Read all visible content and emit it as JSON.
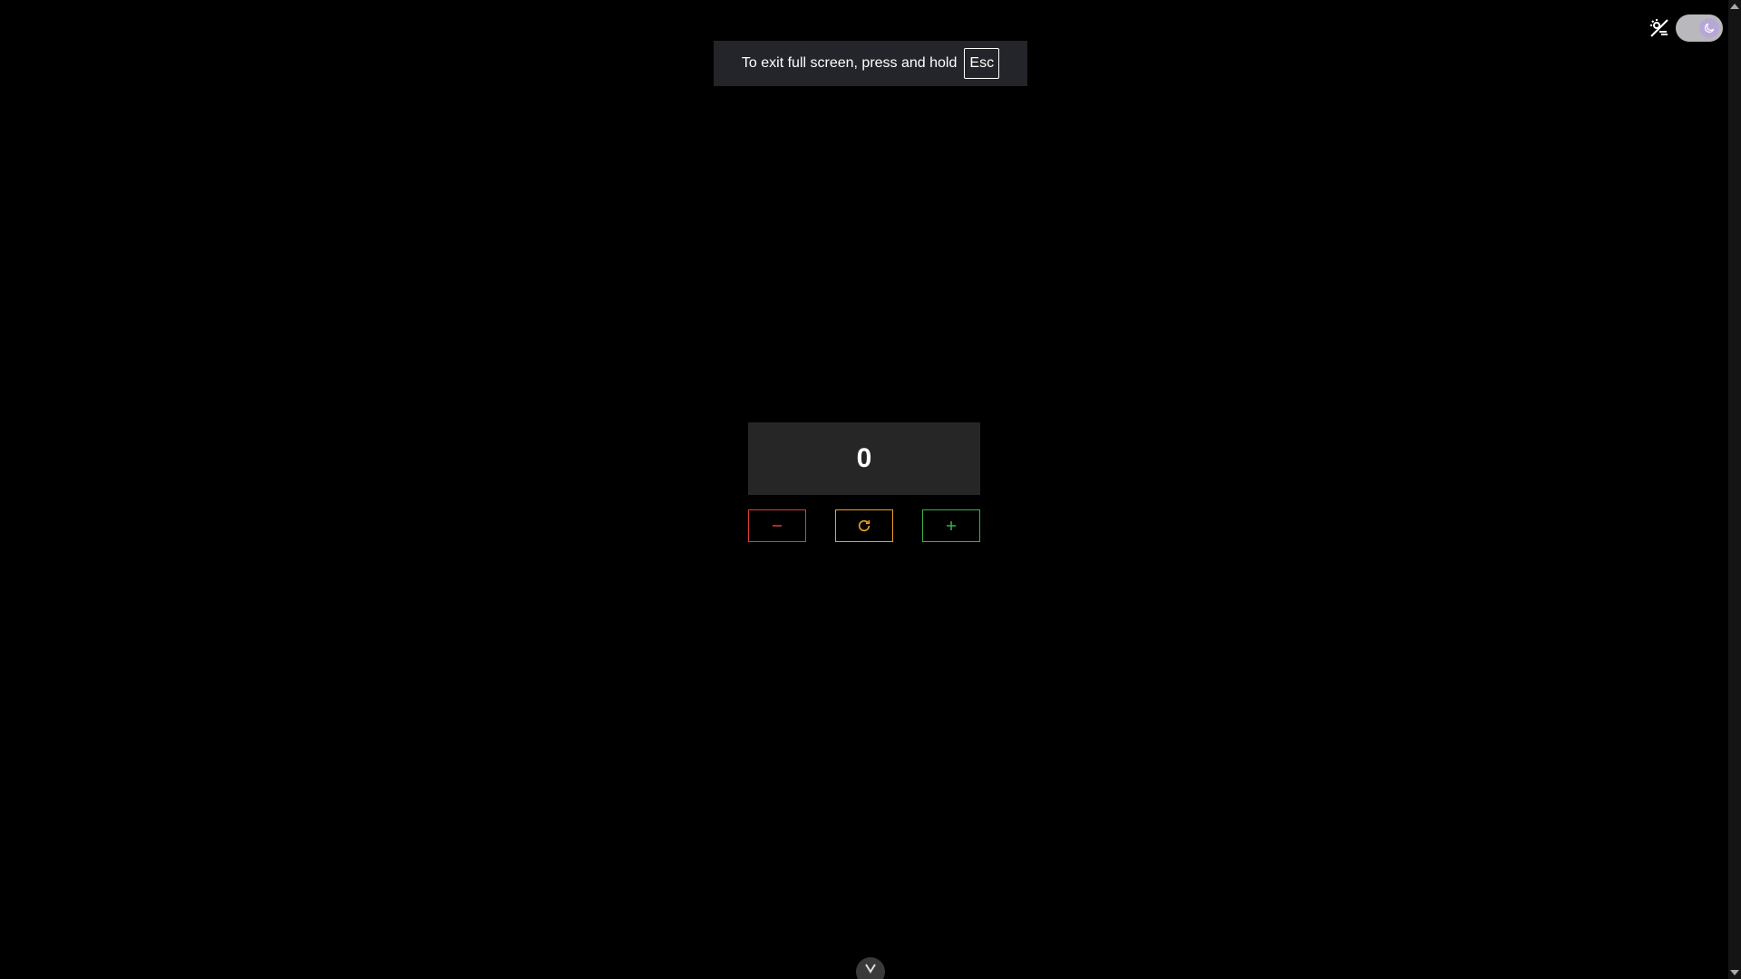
{
  "fullscreen_notice": {
    "text": "To exit full screen, press and hold",
    "key": "Esc"
  },
  "counter": {
    "value": "0",
    "buttons": {
      "decrement_icon": "minus-icon",
      "reset_icon": "refresh-icon",
      "increment_icon": "plus-icon"
    }
  },
  "theme_toggle": {
    "icon_left": "sun-off-icon",
    "knob_icon": "moon-icon",
    "state": "dark"
  },
  "colors": {
    "decrement": "#e03a3a",
    "reset": "#f0a020",
    "increment": "#36b24a",
    "display_bg": "#262626",
    "background": "#000000"
  }
}
